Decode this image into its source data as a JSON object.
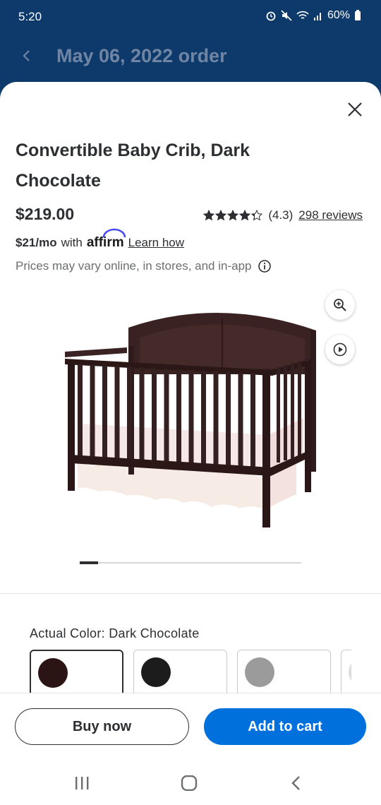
{
  "status_bar": {
    "time": "5:20",
    "battery": "60%"
  },
  "header": {
    "title": "May 06, 2022 order"
  },
  "product": {
    "title": "Convertible Baby Crib, Dark Chocolate",
    "price": "$219.00",
    "rating_value": 4.3,
    "rating_text": "(4.3)",
    "reviews_text": "298 reviews",
    "monthly_price": "$21/mo",
    "monthly_with": "with",
    "affirm_label": "affirm",
    "learn_how": "Learn how",
    "disclaimer": "Prices may vary online, in stores, and in-app"
  },
  "carousel": {
    "current": 1
  },
  "color": {
    "label": "Actual Color: Dark Chocolate",
    "swatches": [
      {
        "color": "#2a1414",
        "selected": true
      },
      {
        "color": "#1c1c1c",
        "selected": false
      },
      {
        "color": "#9b9b9b",
        "selected": false
      },
      {
        "color": "#dcdcdc",
        "selected": false
      }
    ]
  },
  "actions": {
    "buy_now": "Buy now",
    "add_to_cart": "Add to cart"
  },
  "colors": {
    "brand_blue": "#0071dc",
    "header_blue": "#0d3a6b",
    "text": "#2e2f32"
  },
  "icons": [
    "alarm-icon",
    "mute-icon",
    "wifi-icon",
    "signal-icon",
    "battery-icon",
    "back-icon",
    "close-icon",
    "star-icon",
    "info-icon",
    "zoom-in-icon",
    "play-icon",
    "nav-recents-icon",
    "nav-home-icon",
    "nav-back-icon"
  ]
}
